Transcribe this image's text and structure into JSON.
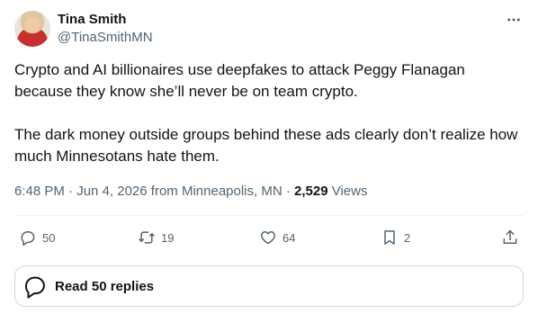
{
  "author": {
    "name": "Tina Smith",
    "handle": "@TinaSmithMN"
  },
  "post": {
    "paragraph_1": "Crypto and AI billionaires use deepfakes to attack Peggy Flanagan because they know she’ll never be on team crypto.",
    "paragraph_2": "The dark money outside groups behind these ads clearly don’t realize how much Minnesotans hate them."
  },
  "meta": {
    "time": "6:48 PM",
    "separator_1": " · ",
    "date": "Jun 4, 2026",
    "location": " from Minneapolis, MN",
    "separator_2": " · ",
    "views_count": "2,529",
    "views_label": " Views"
  },
  "actions": {
    "replies": "50",
    "reposts": "19",
    "likes": "64",
    "bookmarks": "2"
  },
  "read_replies": {
    "label": "Read 50 replies"
  },
  "icons": {
    "more": "more-horizontal-icon",
    "reply": "reply-bubble-icon",
    "repost": "repost-arrows-icon",
    "like": "heart-icon",
    "bookmark": "bookmark-icon",
    "share": "share-upload-icon",
    "read_replies": "reply-bubble-icon"
  },
  "colors": {
    "primary_text": "#0f1419",
    "secondary_text": "#536471",
    "border": "#cfd9de"
  }
}
